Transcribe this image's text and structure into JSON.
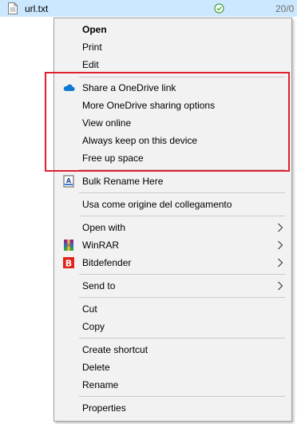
{
  "explorer": {
    "file_name": "url.txt",
    "date": "20/0",
    "sync_status_icon": "check-circle-icon"
  },
  "menu": {
    "open": "Open",
    "print": "Print",
    "edit": "Edit",
    "share_onedrive_link": "Share a OneDrive link",
    "more_onedrive_sharing": "More OneDrive sharing options",
    "view_online": "View online",
    "always_keep": "Always keep on this device",
    "free_up_space": "Free up space",
    "bulk_rename": "Bulk Rename Here",
    "usa_come_origine": "Usa come origine del collegamento",
    "open_with": "Open with",
    "winrar": "WinRAR",
    "bitdefender": "Bitdefender",
    "send_to": "Send to",
    "cut": "Cut",
    "copy": "Copy",
    "create_shortcut": "Create shortcut",
    "delete": "Delete",
    "rename": "Rename",
    "properties": "Properties"
  },
  "colors": {
    "selection": "#cce8ff",
    "menu_bg": "#f2f2f2",
    "highlight_box": "#e0202e",
    "onedrive": "#0f78d4",
    "bitdefender": "#e1251b"
  },
  "icons": [
    "file-icon",
    "check-circle-icon",
    "onedrive-cloud-icon",
    "bulk-rename-icon",
    "winrar-icon",
    "bitdefender-icon",
    "chevron-right-icon"
  ]
}
